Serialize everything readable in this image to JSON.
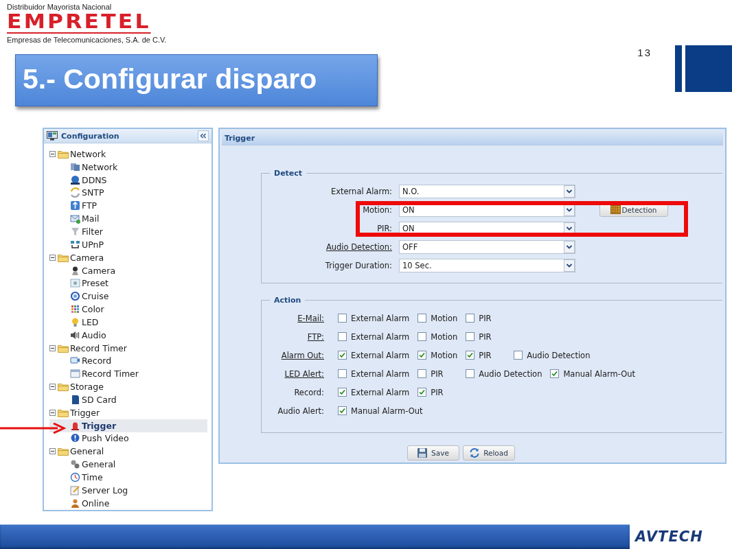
{
  "header": {
    "tagline": "Distribuidor Mayorista Nacional",
    "logo": "EMPRETEL",
    "company": "Empresas de Telecomunicaciones, S.A. de C.V.",
    "page_number": "13"
  },
  "slide_title": "5.- Configurar disparo",
  "sidebar": {
    "title": "Configuration",
    "items": [
      {
        "label": "Network",
        "expanded": true,
        "children": [
          {
            "label": "Network",
            "selected": false
          },
          {
            "label": "DDNS",
            "selected": false
          },
          {
            "label": "SNTP",
            "selected": false
          },
          {
            "label": "FTP",
            "selected": false
          },
          {
            "label": "Mail",
            "selected": false
          },
          {
            "label": "Filter",
            "selected": false
          },
          {
            "label": "UPnP",
            "selected": false
          }
        ]
      },
      {
        "label": "Camera",
        "expanded": true,
        "children": [
          {
            "label": "Camera",
            "selected": false
          },
          {
            "label": "Preset",
            "selected": false
          },
          {
            "label": "Cruise",
            "selected": false
          },
          {
            "label": "Color",
            "selected": false
          },
          {
            "label": "LED",
            "selected": false
          },
          {
            "label": "Audio",
            "selected": false
          }
        ]
      },
      {
        "label": "Record Timer",
        "expanded": true,
        "children": [
          {
            "label": "Record",
            "selected": false
          },
          {
            "label": "Record Timer",
            "selected": false
          }
        ]
      },
      {
        "label": "Storage",
        "expanded": true,
        "children": [
          {
            "label": "SD Card",
            "selected": false
          }
        ]
      },
      {
        "label": "Trigger",
        "expanded": true,
        "children": [
          {
            "label": "Trigger",
            "selected": true
          },
          {
            "label": "Push Video",
            "selected": false
          }
        ]
      },
      {
        "label": "General",
        "expanded": true,
        "children": [
          {
            "label": "General",
            "selected": false
          },
          {
            "label": "Time",
            "selected": false
          },
          {
            "label": "Server Log",
            "selected": false
          },
          {
            "label": "Online",
            "selected": false
          }
        ]
      }
    ]
  },
  "panel": {
    "title": "Trigger",
    "detect": {
      "legend": "Detect",
      "fields": [
        {
          "label": "External Alarm:",
          "link": false,
          "value": "N.O."
        },
        {
          "label": "Motion:",
          "link": false,
          "value": "ON",
          "button": "Detection"
        },
        {
          "label": "PIR:",
          "link": false,
          "value": "ON"
        },
        {
          "label": "Audio Detection:",
          "link": true,
          "value": "OFF"
        },
        {
          "label": "Trigger Duration:",
          "link": false,
          "value": "10 Sec."
        }
      ]
    },
    "action": {
      "legend": "Action",
      "rows": [
        {
          "label": "E-Mail:",
          "link": true,
          "options": [
            {
              "label": "External Alarm",
              "checked": false
            },
            {
              "label": "Motion",
              "checked": false
            },
            {
              "label": "PIR",
              "checked": false
            }
          ]
        },
        {
          "label": "FTP:",
          "link": true,
          "options": [
            {
              "label": "External Alarm",
              "checked": false
            },
            {
              "label": "Motion",
              "checked": false
            },
            {
              "label": "PIR",
              "checked": false
            }
          ]
        },
        {
          "label": "Alarm Out:",
          "link": true,
          "options": [
            {
              "label": "External Alarm",
              "checked": true
            },
            {
              "label": "Motion",
              "checked": true
            },
            {
              "label": "PIR",
              "checked": true
            },
            {
              "label": "Audio Detection",
              "checked": false
            }
          ]
        },
        {
          "label": "LED Alert:",
          "link": true,
          "options": [
            {
              "label": "External Alarm",
              "checked": false
            },
            {
              "label": "PIR",
              "checked": false
            },
            {
              "label": "Audio Detection",
              "checked": false
            },
            {
              "label": "Manual Alarm-Out",
              "checked": true
            }
          ]
        },
        {
          "label": "Record:",
          "link": false,
          "options": [
            {
              "label": "External Alarm",
              "checked": true
            },
            {
              "label": "PIR",
              "checked": true
            }
          ]
        },
        {
          "label": "Audio Alert:",
          "link": false,
          "options": [
            {
              "label": "Manual Alarm-Out",
              "checked": true
            }
          ]
        }
      ]
    },
    "buttons": [
      {
        "label": "Save",
        "kind": "save"
      },
      {
        "label": "Reload",
        "kind": "reload"
      }
    ]
  },
  "footer": {
    "logo": "AVTECH"
  }
}
